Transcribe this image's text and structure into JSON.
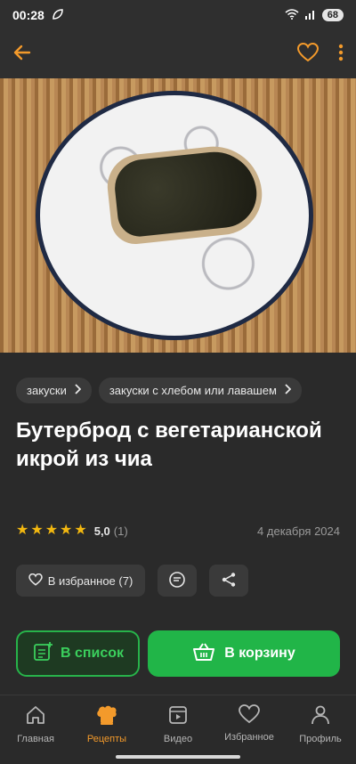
{
  "status": {
    "time": "00:28",
    "battery": "68"
  },
  "header": {
    "back_icon": "arrow-left-icon",
    "favorite_icon": "heart-icon",
    "menu_icon": "kebab-menu-icon",
    "accent": "#f39a2b"
  },
  "tags": [
    {
      "label": "закуски"
    },
    {
      "label": "закуски с хлебом или лавашем"
    }
  ],
  "recipe": {
    "title": "Бутерброд с вегетарианской икрой из чиа",
    "rating": "5,0",
    "rating_count": "(1)",
    "date": "4 декабря 2024",
    "favorite_label": "В избранное (7)"
  },
  "cta": {
    "list_label": "В список",
    "cart_label": "В корзину",
    "overlap_text": "н"
  },
  "nav": [
    {
      "label": "Главная",
      "icon": "home-icon"
    },
    {
      "label": "Рецепты",
      "icon": "chef-hat-icon"
    },
    {
      "label": "Видео",
      "icon": "video-icon"
    },
    {
      "label": "Избранное",
      "icon": "heart-icon"
    },
    {
      "label": "Профиль",
      "icon": "profile-icon"
    }
  ],
  "colors": {
    "green": "#21b548",
    "star": "#f3b810",
    "bg": "#2a2a2a"
  }
}
